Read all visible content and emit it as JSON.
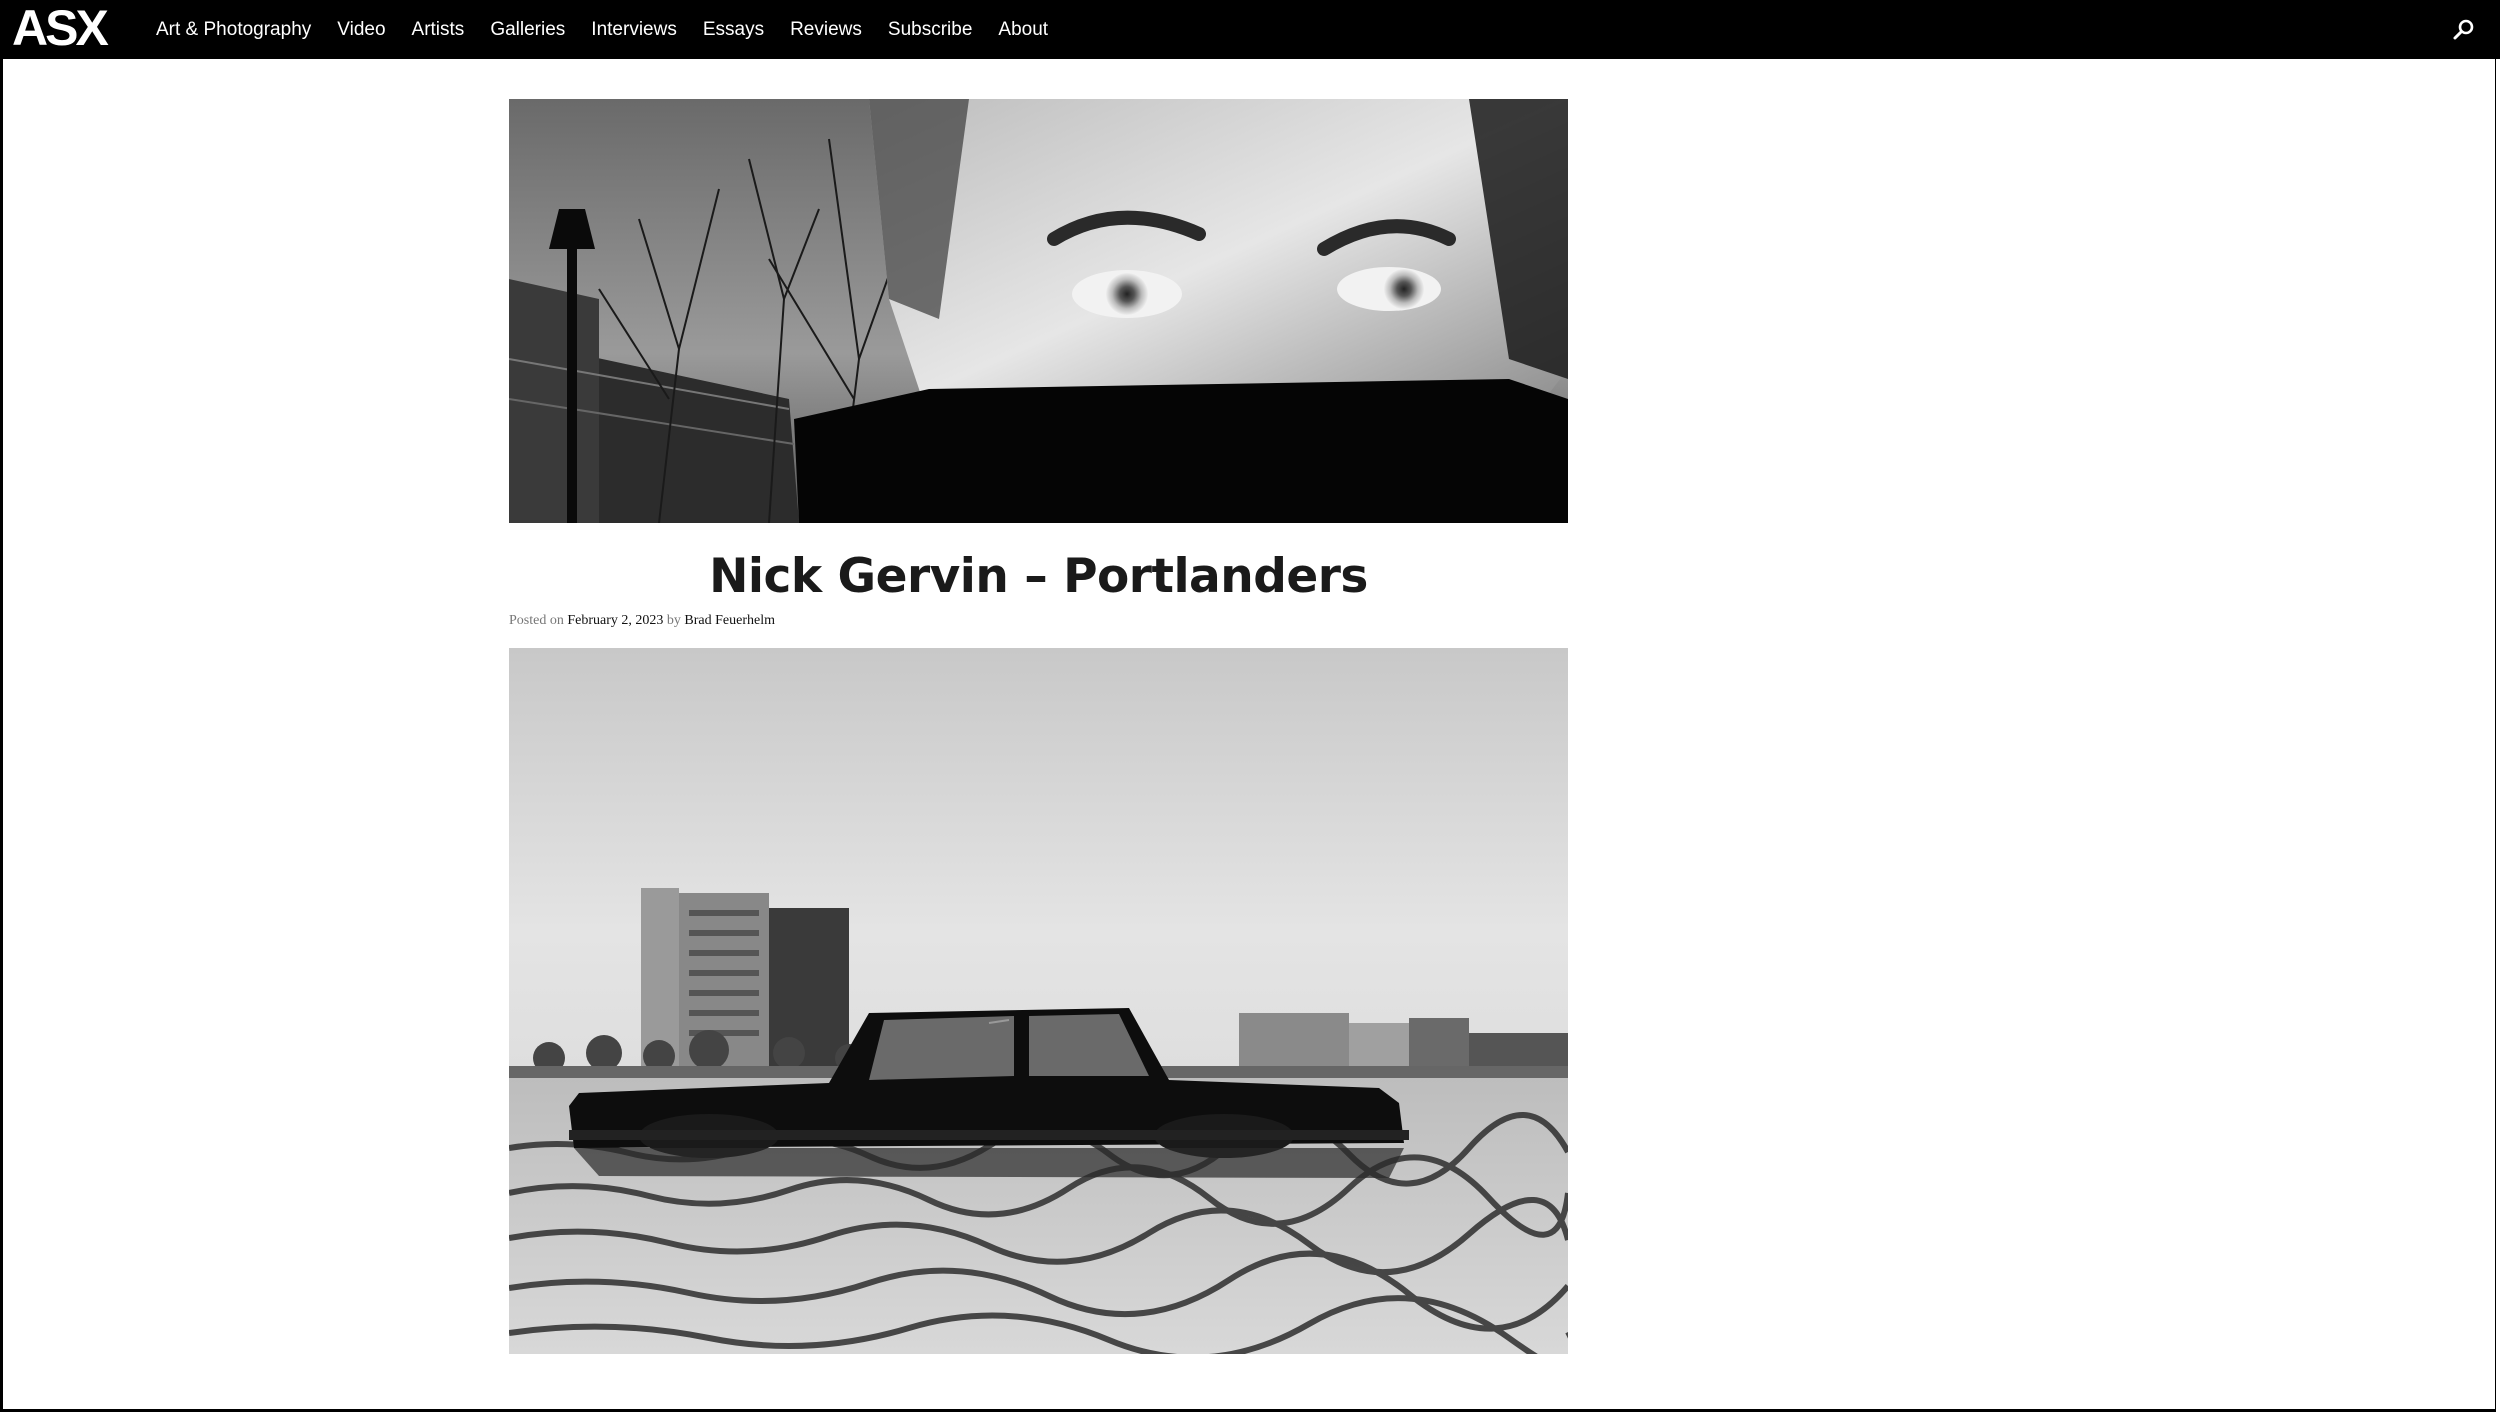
{
  "site": {
    "logo": "ASX"
  },
  "nav": {
    "items": [
      {
        "label": "Art & Photography"
      },
      {
        "label": "Video"
      },
      {
        "label": "Artists"
      },
      {
        "label": "Galleries"
      },
      {
        "label": "Interviews"
      },
      {
        "label": "Essays"
      },
      {
        "label": "Reviews"
      },
      {
        "label": "Subscribe"
      },
      {
        "label": "About"
      }
    ],
    "search_icon": "search-icon"
  },
  "post": {
    "title": "Nick Gervin – Portlanders",
    "posted_on_label": "Posted on",
    "date": "February 2, 2023",
    "by_label": "by",
    "author": "Brad Feuerhelm"
  },
  "colors": {
    "nav_background": "#000000",
    "nav_text": "#ffffff",
    "title_text": "#1a1a1a"
  }
}
